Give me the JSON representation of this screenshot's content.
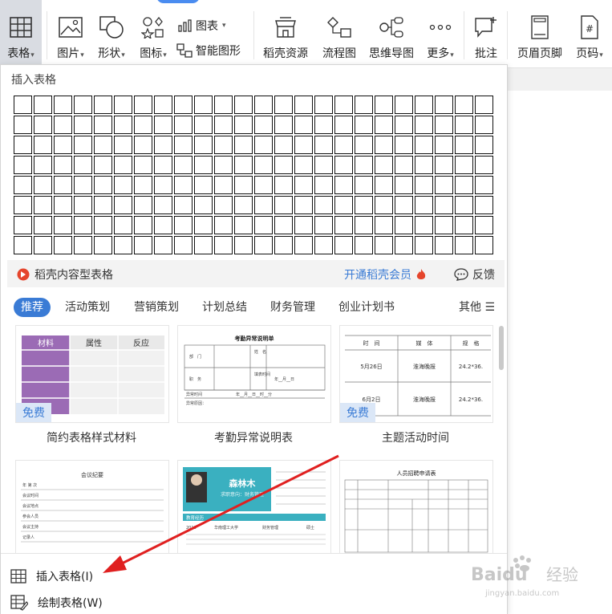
{
  "toolbar": {
    "items": [
      {
        "label": "表格",
        "icon": "table-icon",
        "caret": true
      },
      {
        "label": "图片",
        "icon": "image-icon",
        "caret": true
      },
      {
        "label": "形状",
        "icon": "shape-icon",
        "caret": true
      },
      {
        "label": "图标",
        "icon": "icons-icon",
        "caret": true
      },
      {
        "label": "稻壳资源",
        "icon": "store-icon",
        "caret": false
      },
      {
        "label": "流程图",
        "icon": "flowchart-icon",
        "caret": false
      },
      {
        "label": "思维导图",
        "icon": "mindmap-icon",
        "caret": false
      },
      {
        "label": "更多",
        "icon": "more-icon",
        "caret": true
      },
      {
        "label": "批注",
        "icon": "comment-icon",
        "caret": false
      },
      {
        "label": "页眉页脚",
        "icon": "header-footer-icon",
        "caret": false
      },
      {
        "label": "页码",
        "icon": "page-number-icon",
        "caret": true
      }
    ],
    "chart_label": "图表",
    "smart_shape_label": "智能图形"
  },
  "panel": {
    "title": "插入表格",
    "grid_cols": 24,
    "grid_rows": 8,
    "docer_label": "稻壳内容型表格",
    "vip_label": "开通稻壳会员",
    "feedback_label": "反馈",
    "categories": [
      "推荐",
      "活动策划",
      "营销策划",
      "计划总结",
      "财务管理",
      "创业计划书"
    ],
    "more_label": "其他",
    "templates": [
      {
        "caption": "简约表格样式材料",
        "free": "免费",
        "th": [
          "材料",
          "属性",
          "反应"
        ]
      },
      {
        "caption": "考勤异常说明表",
        "free": "",
        "title": "考勤异常说明单",
        "rows": [
          "部　门",
          "姓　名",
          "职　务",
          "填表时间",
          "年__月__日",
          "异常时间",
          "年__月__日__时__分",
          "异常原因："
        ]
      },
      {
        "caption": "主题活动时间",
        "free": "免费",
        "th": [
          "时　间",
          "媒　体",
          "规　格"
        ],
        "rows": [
          [
            "5月26日",
            "淮海晚报",
            "24.2*36."
          ],
          [
            "6月2日",
            "淮海晚报",
            "24.2*36."
          ]
        ]
      },
      {
        "caption": "",
        "free": "",
        "title": "会议纪要",
        "rows": [
          "年 第 次",
          "会议时间",
          "会议地点",
          "参会人员",
          "会议主持",
          "记录人"
        ]
      },
      {
        "caption": "",
        "free": "",
        "name": "森林木",
        "subtitle": "求职意向：财务管理",
        "section": "教育经历",
        "school": "华南理工大学",
        "major": "财务管理",
        "degree": "硕士",
        "years": "2016"
      },
      {
        "caption": "",
        "free": "",
        "title": "人员招聘申请表"
      }
    ],
    "footer": [
      {
        "label": "插入表格(I)",
        "icon": "insert-table-icon"
      },
      {
        "label": "绘制表格(W)",
        "icon": "draw-table-icon"
      }
    ]
  },
  "watermark": {
    "logo": "Baidu",
    "name": "经验",
    "url": "jingyan.baidu.com"
  },
  "colors": {
    "accent": "#3a7bd5",
    "arrow": "#e02020",
    "purple": "#9b6bb5"
  }
}
